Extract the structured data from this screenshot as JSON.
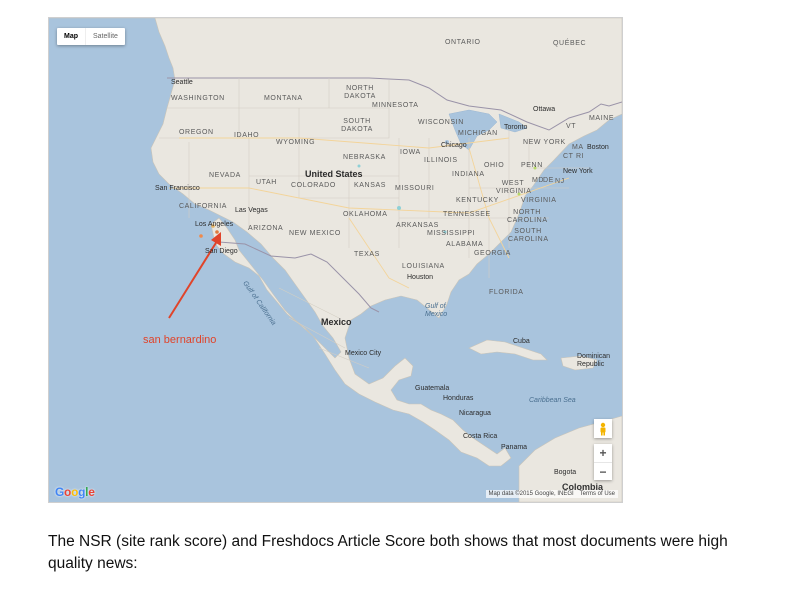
{
  "map": {
    "type_buttons": [
      "Map",
      "Satellite"
    ],
    "active_type": "Map",
    "labels": {
      "countries": [
        "United States",
        "Mexico"
      ],
      "provinces": [
        "ONTARIO",
        "QUÉBEC"
      ],
      "states": [
        "WASHINGTON",
        "MONTANA",
        "NORTH DAKOTA",
        "MINNESOTA",
        "OREGON",
        "IDAHO",
        "SOUTH DAKOTA",
        "WISCONSIN",
        "MICHIGAN",
        "WYOMING",
        "NEBRASKA",
        "IOWA",
        "ILLINOIS",
        "OHIO",
        "PENN",
        "NEVADA",
        "UTAH",
        "COLORADO",
        "KANSAS",
        "MISSOURI",
        "INDIANA",
        "WEST VIRGINIA",
        "VIRGINIA",
        "CALIFORNIA",
        "OKLAHOMA",
        "TENNESSEE",
        "KENTUCKY",
        "NORTH CAROLINA",
        "ARIZONA",
        "NEW MEXICO",
        "ARKANSAS",
        "MISSISSIPPI",
        "SOUTH CAROLINA",
        "ALABAMA",
        "GEORGIA",
        "TEXAS",
        "LOUISIANA",
        "FLORIDA",
        "NEW YORK",
        "VT",
        "MAINE",
        "MA",
        "CT RI",
        "MD",
        "DE",
        "NJ"
      ],
      "cities": [
        "Seattle",
        "Ottawa",
        "Toronto",
        "Chicago",
        "Boston",
        "New York",
        "San Francisco",
        "Las Vegas",
        "Los Angeles",
        "San Diego",
        "Houston",
        "Mexico City",
        "Cuba",
        "Dominican Republic",
        "Guatemala",
        "Honduras",
        "Nicaragua",
        "Costa Rica",
        "Panama",
        "Bogota",
        "Colombia"
      ],
      "seas": [
        "Gulf of Mexico",
        "Gulf of California",
        "Caribbean Sea"
      ]
    },
    "annotation": "san bernardino",
    "logo": "Google",
    "attribution": "Map data ©2015 Google, INEGI",
    "terms": "Terms of Use",
    "zoom_in": "+",
    "zoom_out": "−"
  },
  "caption": "The NSR (site rank score) and Freshdocs Article Score both shows that most documents were high quality news:"
}
